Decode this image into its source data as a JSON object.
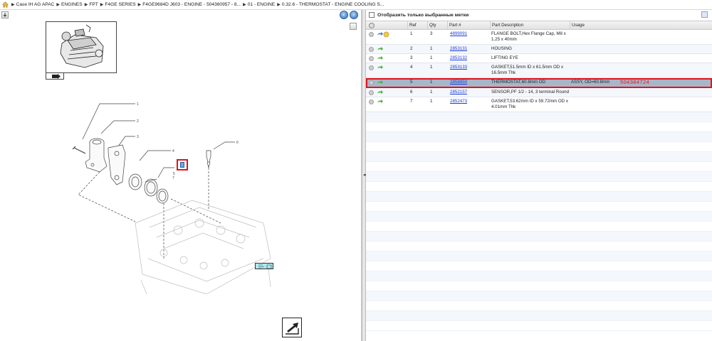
{
  "breadcrumb": {
    "items": [
      "Case IH AG APAC",
      "ENGINES",
      "FPT",
      "F4GE SERIES",
      "F4GE9684D J603 - ENGINE - 504360957 - 8...",
      "01 - ENGINE",
      "0.32.6 - THERMOSTAT - ENGINE COOLING S..."
    ]
  },
  "filter": {
    "label": "Отобразить только выбранные метки",
    "checked": false
  },
  "table": {
    "columns": [
      "Ref",
      "Qty",
      "Part #",
      "Part Description",
      "Usage"
    ],
    "rows": [
      {
        "ref": "1",
        "qty": "3",
        "part": "4899091",
        "desc": "FLANGE BOLT,Hex Flange Cap, M8 x 1.25 x 40mm",
        "usage": "",
        "arrow": "blue-green",
        "selected": false
      },
      {
        "ref": "2",
        "qty": "1",
        "part": "2853131",
        "desc": "HOUSING",
        "usage": "",
        "arrow": "green",
        "selected": false
      },
      {
        "ref": "3",
        "qty": "1",
        "part": "2853132",
        "desc": "LIFTING EYE",
        "usage": "",
        "arrow": "green",
        "selected": false
      },
      {
        "ref": "4",
        "qty": "1",
        "part": "2853133",
        "desc": "GASKET,51.5mm ID x 61.5mm OD x 16.5mm Thk",
        "usage": "",
        "arrow": "green",
        "selected": false
      },
      {
        "ref": "5",
        "qty": "1",
        "part": "2858850",
        "desc": "THERMOSTAT,60.8mm OD",
        "usage": "ASSY, OD=60.8mm",
        "arrow": "green",
        "selected": true,
        "note": "504384724"
      },
      {
        "ref": "6",
        "qty": "1",
        "part": "2852157",
        "desc": "SENSOR,PF 1/2 - 14, 3 terminal Round",
        "usage": "",
        "arrow": "green",
        "selected": false
      },
      {
        "ref": "7",
        "qty": "1",
        "part": "2852473",
        "desc": "GASKET,53.62mm ID x 59.72mm OD x 4.01mm Thk",
        "usage": "",
        "arrow": "green",
        "selected": false
      }
    ]
  },
  "diagram": {
    "callouts": [
      "1",
      "2",
      "3",
      "4",
      "5",
      "6",
      "7"
    ]
  },
  "colors": {
    "selected_row": "#a9b6c8",
    "highlight": "#e0141e",
    "link": "#1a3ad6",
    "callout_fill": "#aee8f0"
  }
}
